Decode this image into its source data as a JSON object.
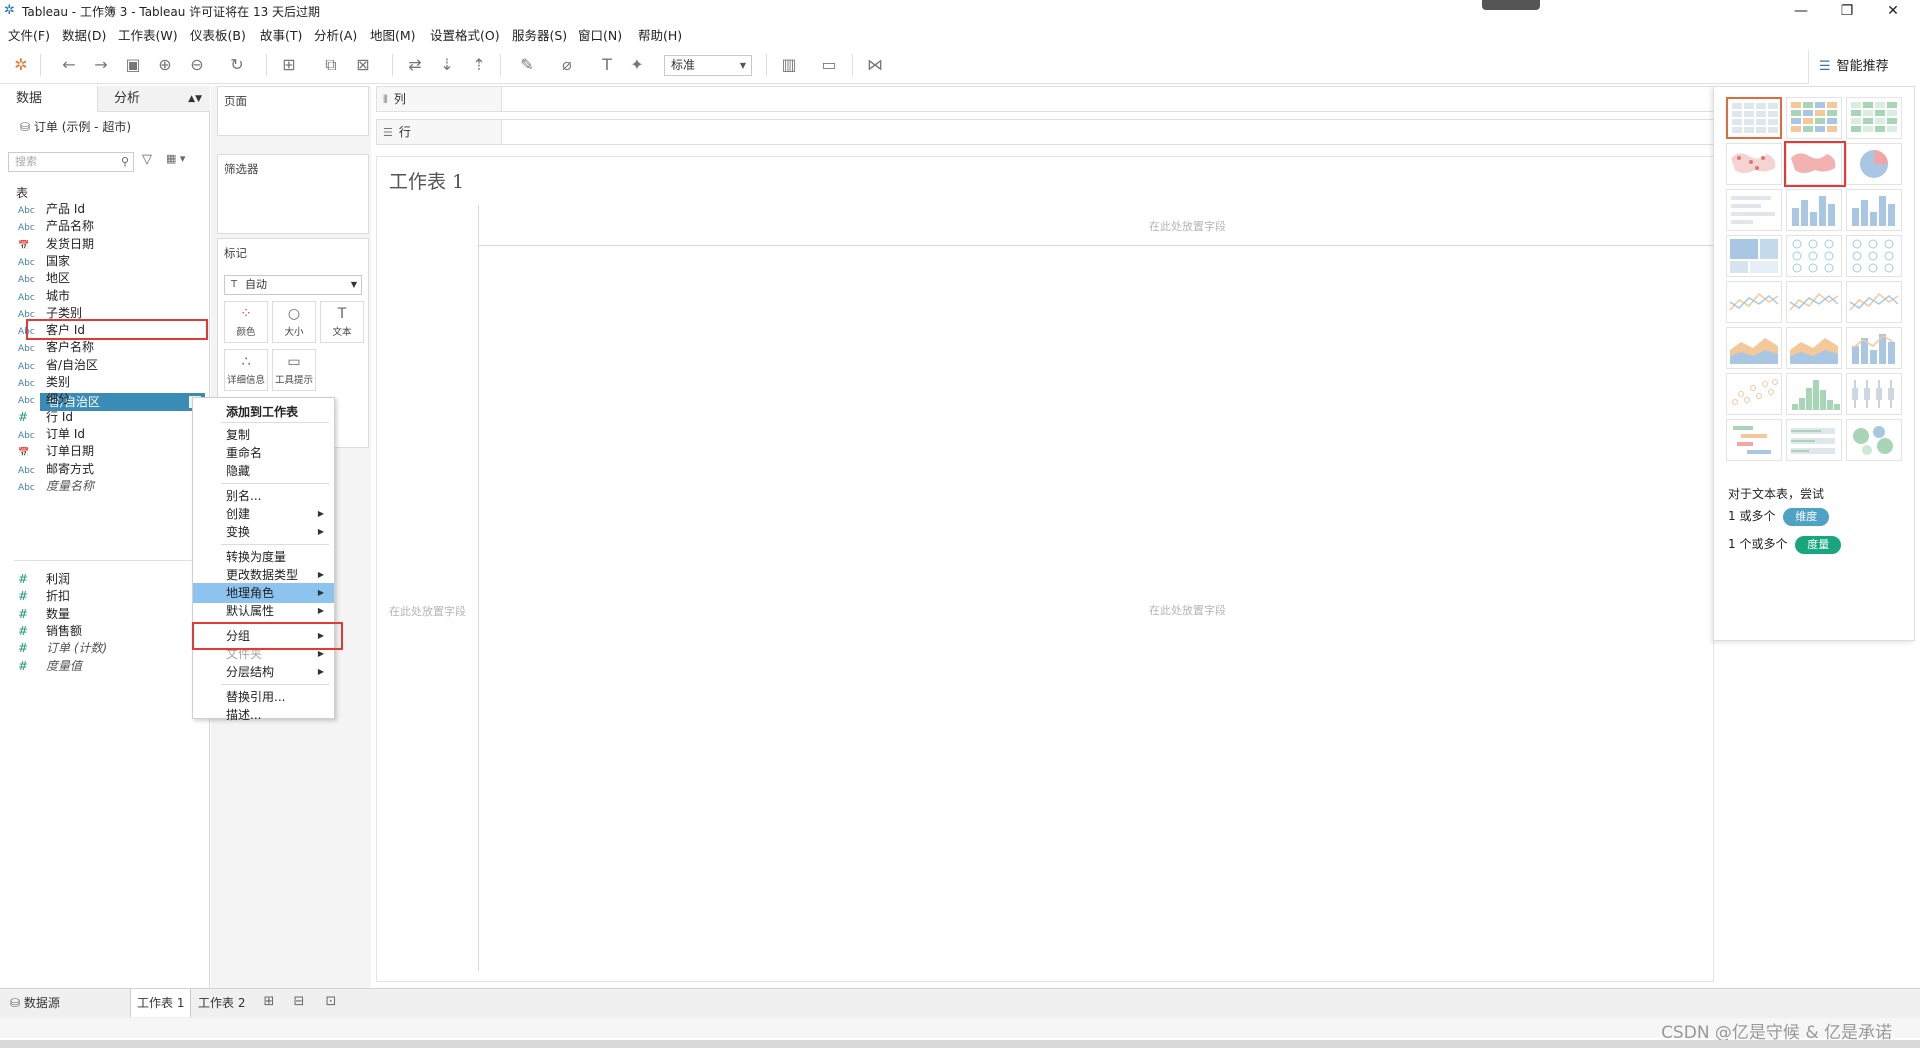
{
  "window": {
    "title": "Tableau - 工作簿 3 - Tableau 许可证将在 13 天后过期",
    "controls": [
      "—",
      "❐",
      "✕"
    ]
  },
  "menu": [
    "文件(F)",
    "数据(D)",
    "工作表(W)",
    "仪表板(B)",
    "故事(T)",
    "分析(A)",
    "地图(M)",
    "设置格式(O)",
    "服务器(S)",
    "窗口(N)",
    "帮助(H)"
  ],
  "toolbar": {
    "fit_value": "标准",
    "showme_label": "智能推荐"
  },
  "datapane": {
    "tab_data": "数据",
    "tab_analysis": "分析",
    "datasource": "订单 (示例 - 超市)",
    "search_placeholder": "搜索",
    "tables_label": "表",
    "dimensions": [
      {
        "type": "Abc",
        "name": "产品 Id"
      },
      {
        "type": "Abc",
        "name": "产品名称"
      },
      {
        "type": "📅",
        "name": "发货日期"
      },
      {
        "type": "Abc",
        "name": "国家"
      },
      {
        "type": "Abc",
        "name": "地区"
      },
      {
        "type": "Abc",
        "name": "城市"
      },
      {
        "type": "Abc",
        "name": "子类别"
      },
      {
        "type": "Abc",
        "name": "客户 Id"
      },
      {
        "type": "Abc",
        "name": "客户名称"
      },
      {
        "type": "Abc",
        "name": "省/自治区"
      },
      {
        "type": "Abc",
        "name": "类别"
      },
      {
        "type": "Abc",
        "name": "细分"
      },
      {
        "type": "#",
        "name": "行 Id"
      },
      {
        "type": "Abc",
        "name": "订单 Id"
      },
      {
        "type": "📅",
        "name": "订单日期"
      },
      {
        "type": "Abc",
        "name": "邮寄方式"
      },
      {
        "type": "Abc",
        "name": "度量名称"
      }
    ],
    "measures": [
      {
        "type": "#",
        "name": "利润"
      },
      {
        "type": "#",
        "name": "折扣"
      },
      {
        "type": "#",
        "name": "数量"
      },
      {
        "type": "#",
        "name": "销售额"
      },
      {
        "type": "#",
        "name": "订单 (计数)"
      },
      {
        "type": "#",
        "name": "度量值"
      }
    ]
  },
  "shelves": {
    "pages": "页面",
    "filters": "筛选器",
    "marks": "标记",
    "marks_type": "自动",
    "mark_buttons": [
      "颜色",
      "大小",
      "文本",
      "详细信息",
      "工具提示"
    ],
    "columns": "列",
    "rows": "行"
  },
  "canvas": {
    "sheet_title": "工作表 1",
    "drop_field_text": "在此处放置字段"
  },
  "context_menu": {
    "items": [
      {
        "label": "添加到工作表",
        "bold": true
      },
      {
        "label": "复制"
      },
      {
        "label": "重命名"
      },
      {
        "label": "隐藏"
      },
      {
        "label": "别名..."
      },
      {
        "label": "创建",
        "sub": true
      },
      {
        "label": "变换",
        "sub": true
      },
      {
        "label": "转换为度量"
      },
      {
        "label": "更改数据类型",
        "sub": true
      },
      {
        "label": "地理角色",
        "sub": true,
        "highlight": true
      },
      {
        "label": "默认属性",
        "sub": true
      },
      {
        "label": "分组",
        "sub": true
      },
      {
        "label": "文件夹",
        "sub": true,
        "disabled": true
      },
      {
        "label": "分层结构",
        "sub": true
      },
      {
        "label": "替换引用..."
      },
      {
        "label": "描述..."
      }
    ]
  },
  "showme": {
    "hint_title": "对于文本表，尝试",
    "line1_prefix": "1 或多个",
    "line1_pill": "维度",
    "line2_prefix": "1 个或多个",
    "line2_pill": "度量",
    "colors": {
      "dimension": "#4ea2c4",
      "measure": "#19a67e"
    }
  },
  "bottom": {
    "datasource_tab": "数据源",
    "sheets": [
      "工作表 1",
      "工作表 2"
    ]
  },
  "watermark": "CSDN @亿是守候 & 亿是承诺"
}
